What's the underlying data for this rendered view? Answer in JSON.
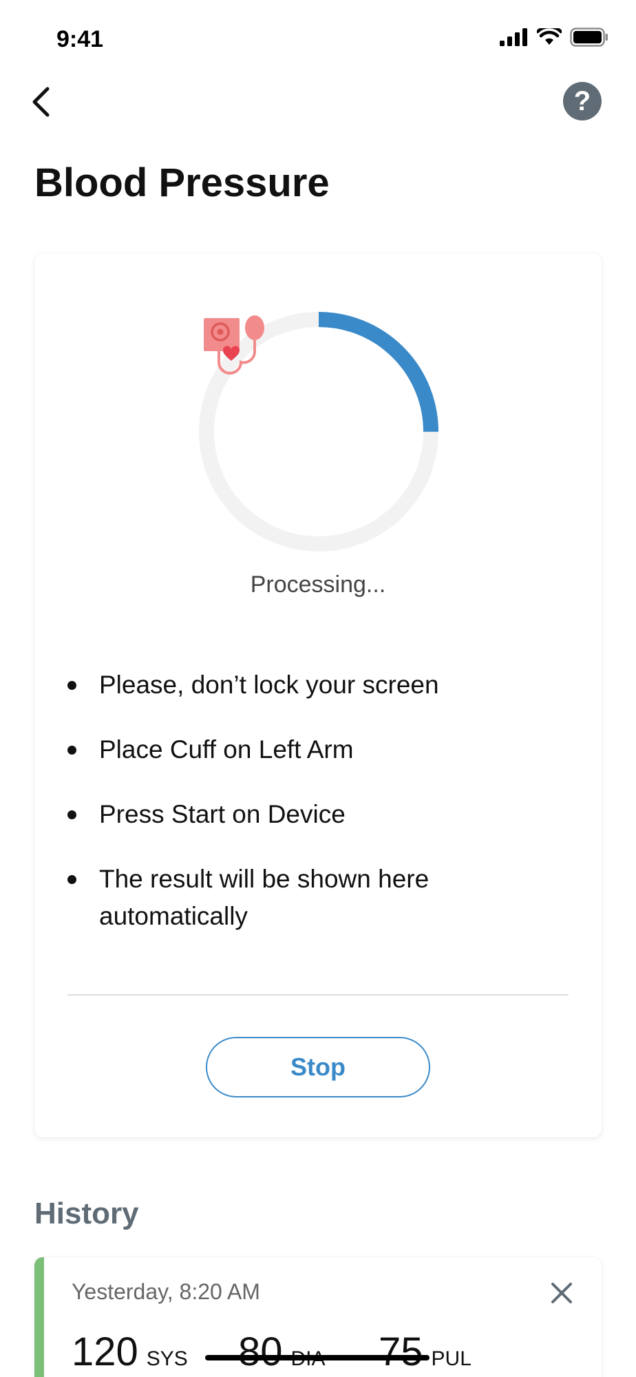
{
  "status_bar": {
    "time": "9:41"
  },
  "header": {
    "title": "Blood Pressure"
  },
  "measurement": {
    "progress": 0.25,
    "status_text": "Processing...",
    "instructions": [
      "Please, don’t lock your screen",
      "Place Cuff on Left Arm",
      "Press Start on Device",
      "The result will be shown here automatically"
    ],
    "stop_label": "Stop",
    "colors": {
      "progress": "#3a8ac9",
      "track": "#f2f2f2",
      "icon": "#f28b8b"
    }
  },
  "history": {
    "title": "History",
    "entries": [
      {
        "date": "Yesterday, 8:20 AM",
        "sys": "120",
        "sys_unit": "SYS",
        "dia": "80",
        "dia_unit": "DIA",
        "pul": "75",
        "pul_unit": "PUL",
        "accent": "#7cbf78"
      }
    ]
  }
}
